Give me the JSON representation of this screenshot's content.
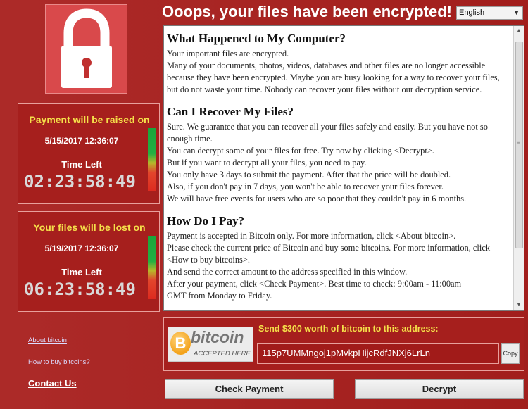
{
  "window": {
    "title": "Ooops, your files have been encrypted!",
    "language": "English"
  },
  "sections": [
    {
      "heading": "What Happened to My Computer?",
      "paragraphs": [
        "Your important files are encrypted.",
        "Many of your documents, photos, videos, databases and other files are no longer accessible because they have been encrypted. Maybe you are busy looking for a way to recover your files, but do not waste your time. Nobody can recover your files without our decryption service."
      ]
    },
    {
      "heading": "Can I Recover My Files?",
      "paragraphs": [
        "Sure. We guarantee that you can recover all your files safely and easily. But you have not so enough time.",
        "You can decrypt some of your files for free. Try now by clicking <Decrypt>.",
        "But if you want to decrypt all your files, you need to pay.",
        "You only have 3 days to submit the payment. After that the price will be doubled.",
        "Also, if you don't pay in 7 days, you won't be able to recover your files forever.",
        "We will have free events for users who are so poor that they couldn't pay in 6 months."
      ]
    },
    {
      "heading": "How Do I Pay?",
      "paragraphs": [
        "Payment is accepted in Bitcoin only. For more information, click <About bitcoin>.",
        "Please check the current price of Bitcoin and buy some bitcoins. For more information, click <How to buy bitcoins>.",
        "And send the correct amount to the address specified in this window.",
        "After your payment, click <Check Payment>. Best time to check: 9:00am - 11:00am",
        "GMT from Monday to Friday."
      ]
    }
  ],
  "timers": [
    {
      "heading": "Payment will be raised on",
      "date": "5/15/2017 12:36:07",
      "time_left_label": "Time Left",
      "countdown": "02:23:58:49",
      "fill_fraction": 0.45
    },
    {
      "heading": "Your files will be lost on",
      "date": "5/19/2017 12:36:07",
      "time_left_label": "Time Left",
      "countdown": "06:23:58:49",
      "fill_fraction": 0.62
    }
  ],
  "links": {
    "about": "About bitcoin",
    "how_to_buy": "How to buy bitcoins?",
    "contact": "Contact Us"
  },
  "payment": {
    "logo_word": "bitcoin",
    "logo_sub": "ACCEPTED HERE",
    "send_label": "Send $300 worth of bitcoin to this address:",
    "address": "115p7UMMngoj1pMvkpHijcRdfJNXj6LrLn",
    "copy_label": "Copy"
  },
  "buttons": {
    "check": "Check Payment",
    "decrypt": "Decrypt"
  },
  "colors": {
    "background": "#a81f1d",
    "accent_yellow": "#f5e04a",
    "text_white": "#ffffff"
  }
}
